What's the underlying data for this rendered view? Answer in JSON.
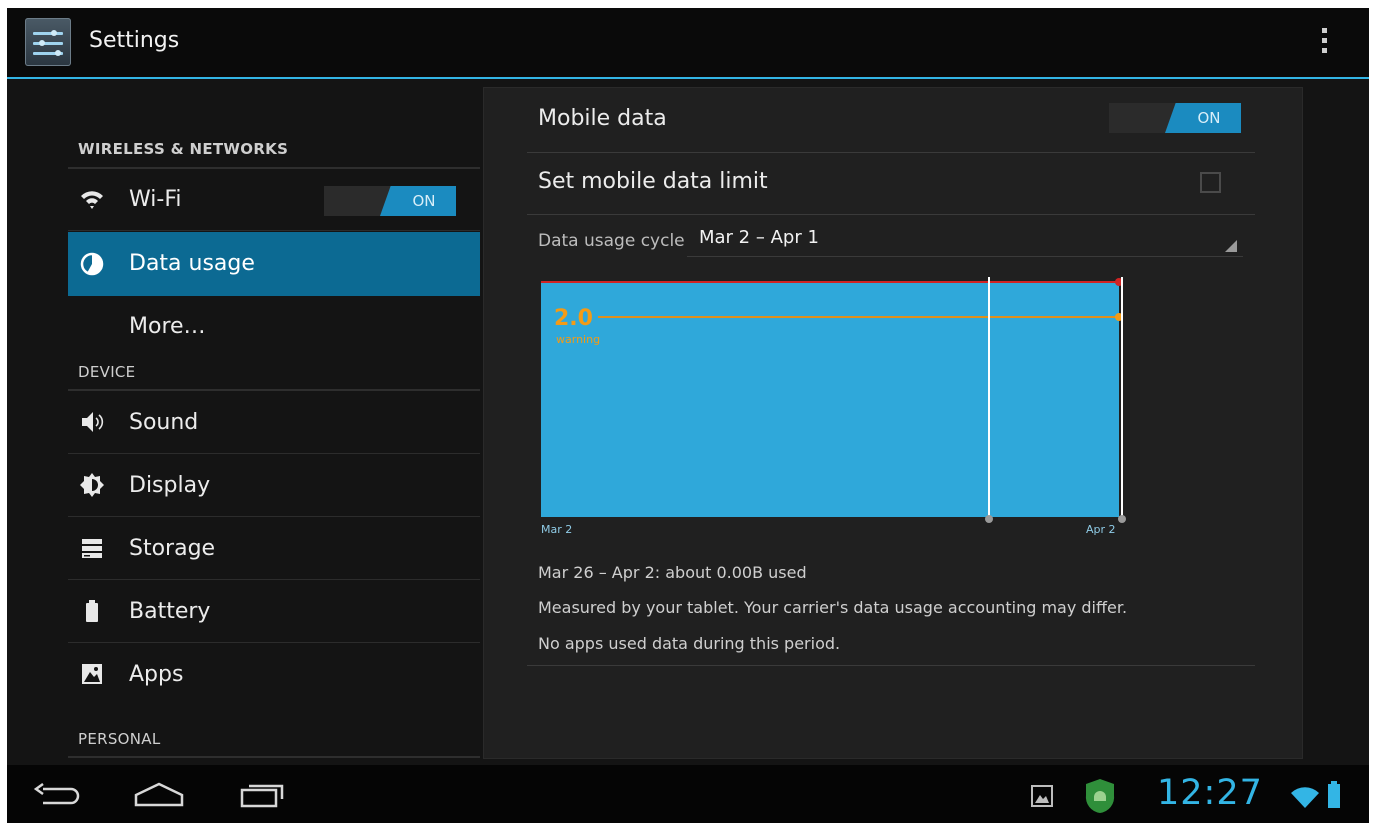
{
  "app": {
    "title": "Settings"
  },
  "sidebar": {
    "sections": [
      {
        "header": "WIRELESS & NETWORKS"
      },
      {
        "header": "DEVICE"
      },
      {
        "header": "PERSONAL"
      }
    ],
    "wifi": {
      "label": "Wi-Fi",
      "toggle": "ON",
      "icon": "wifi-icon"
    },
    "data_usage": {
      "label": "Data usage",
      "icon": "data-usage-icon"
    },
    "more": {
      "label": "More…"
    },
    "sound": {
      "label": "Sound",
      "icon": "speaker-icon"
    },
    "display": {
      "label": "Display",
      "icon": "brightness-icon"
    },
    "storage": {
      "label": "Storage",
      "icon": "storage-icon"
    },
    "battery": {
      "label": "Battery",
      "icon": "battery-icon"
    },
    "apps": {
      "label": "Apps",
      "icon": "apps-icon"
    }
  },
  "detail": {
    "mobile_data": {
      "label": "Mobile data",
      "toggle": "ON"
    },
    "data_limit": {
      "label": "Set mobile data limit",
      "checked": false
    },
    "cycle": {
      "label": "Data usage cycle",
      "value": "Mar 2 – Apr 1"
    },
    "summary": "Mar 26 – Apr 2: about 0.00B used",
    "disclaimer": "Measured by your tablet. Your carrier's data usage accounting may differ.",
    "no_apps": "No apps used data during this period."
  },
  "chart_data": {
    "type": "area",
    "x_start_label": "Mar 2",
    "x_end_label": "Apr 2",
    "warning_value": "2.0",
    "warning_label": "warning",
    "colors": {
      "fill": "#2fa8da",
      "warning": "#f39b16",
      "limit": "#d12424",
      "range_marker": "#ffffff"
    }
  },
  "statusbar": {
    "time": "12:27",
    "colors": {
      "accent": "#33b5e5"
    }
  }
}
